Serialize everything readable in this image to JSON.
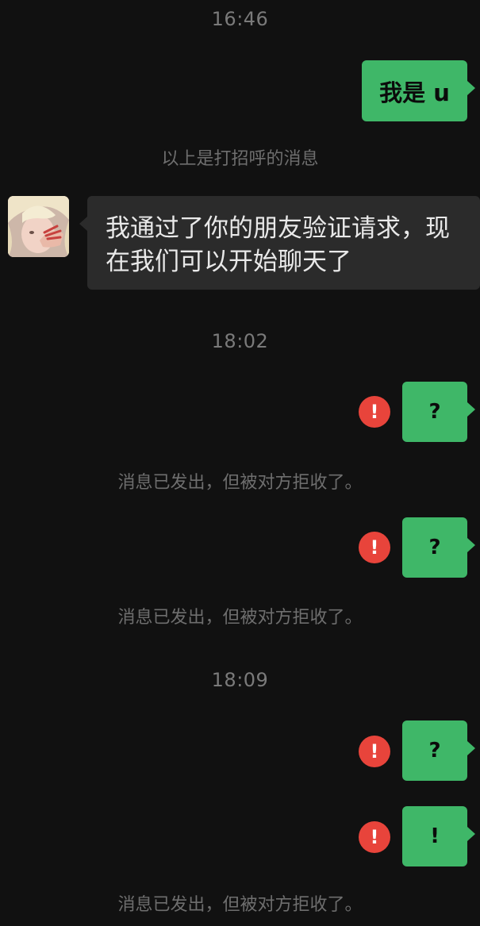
{
  "timestamps": {
    "t1": "16:46",
    "t2": "18:02",
    "t3": "18:09"
  },
  "greeting": {
    "text": "我是 u",
    "system_note": "以上是打招呼的消息"
  },
  "friend": {
    "message_line1": "我通过了你的朋友验证请求，现",
    "message_line2": "在我们可以开始聊天了",
    "avatar_icon": "user-avatar-icon"
  },
  "sent": [
    {
      "text": "?",
      "rejected": "消息已发出，但被对方拒收了。"
    },
    {
      "text": "?",
      "rejected": "消息已发出，但被对方拒收了。"
    },
    {
      "text": "?"
    },
    {
      "text": "!",
      "rejected": "消息已发出，但被对方拒收了。"
    }
  ],
  "error_mark": "!",
  "colors": {
    "background": "#111111",
    "outgoing_bubble": "#3fb768",
    "incoming_bubble": "#2b2b2b",
    "error": "#e8443b",
    "muted_text": "#7a7a7a"
  }
}
